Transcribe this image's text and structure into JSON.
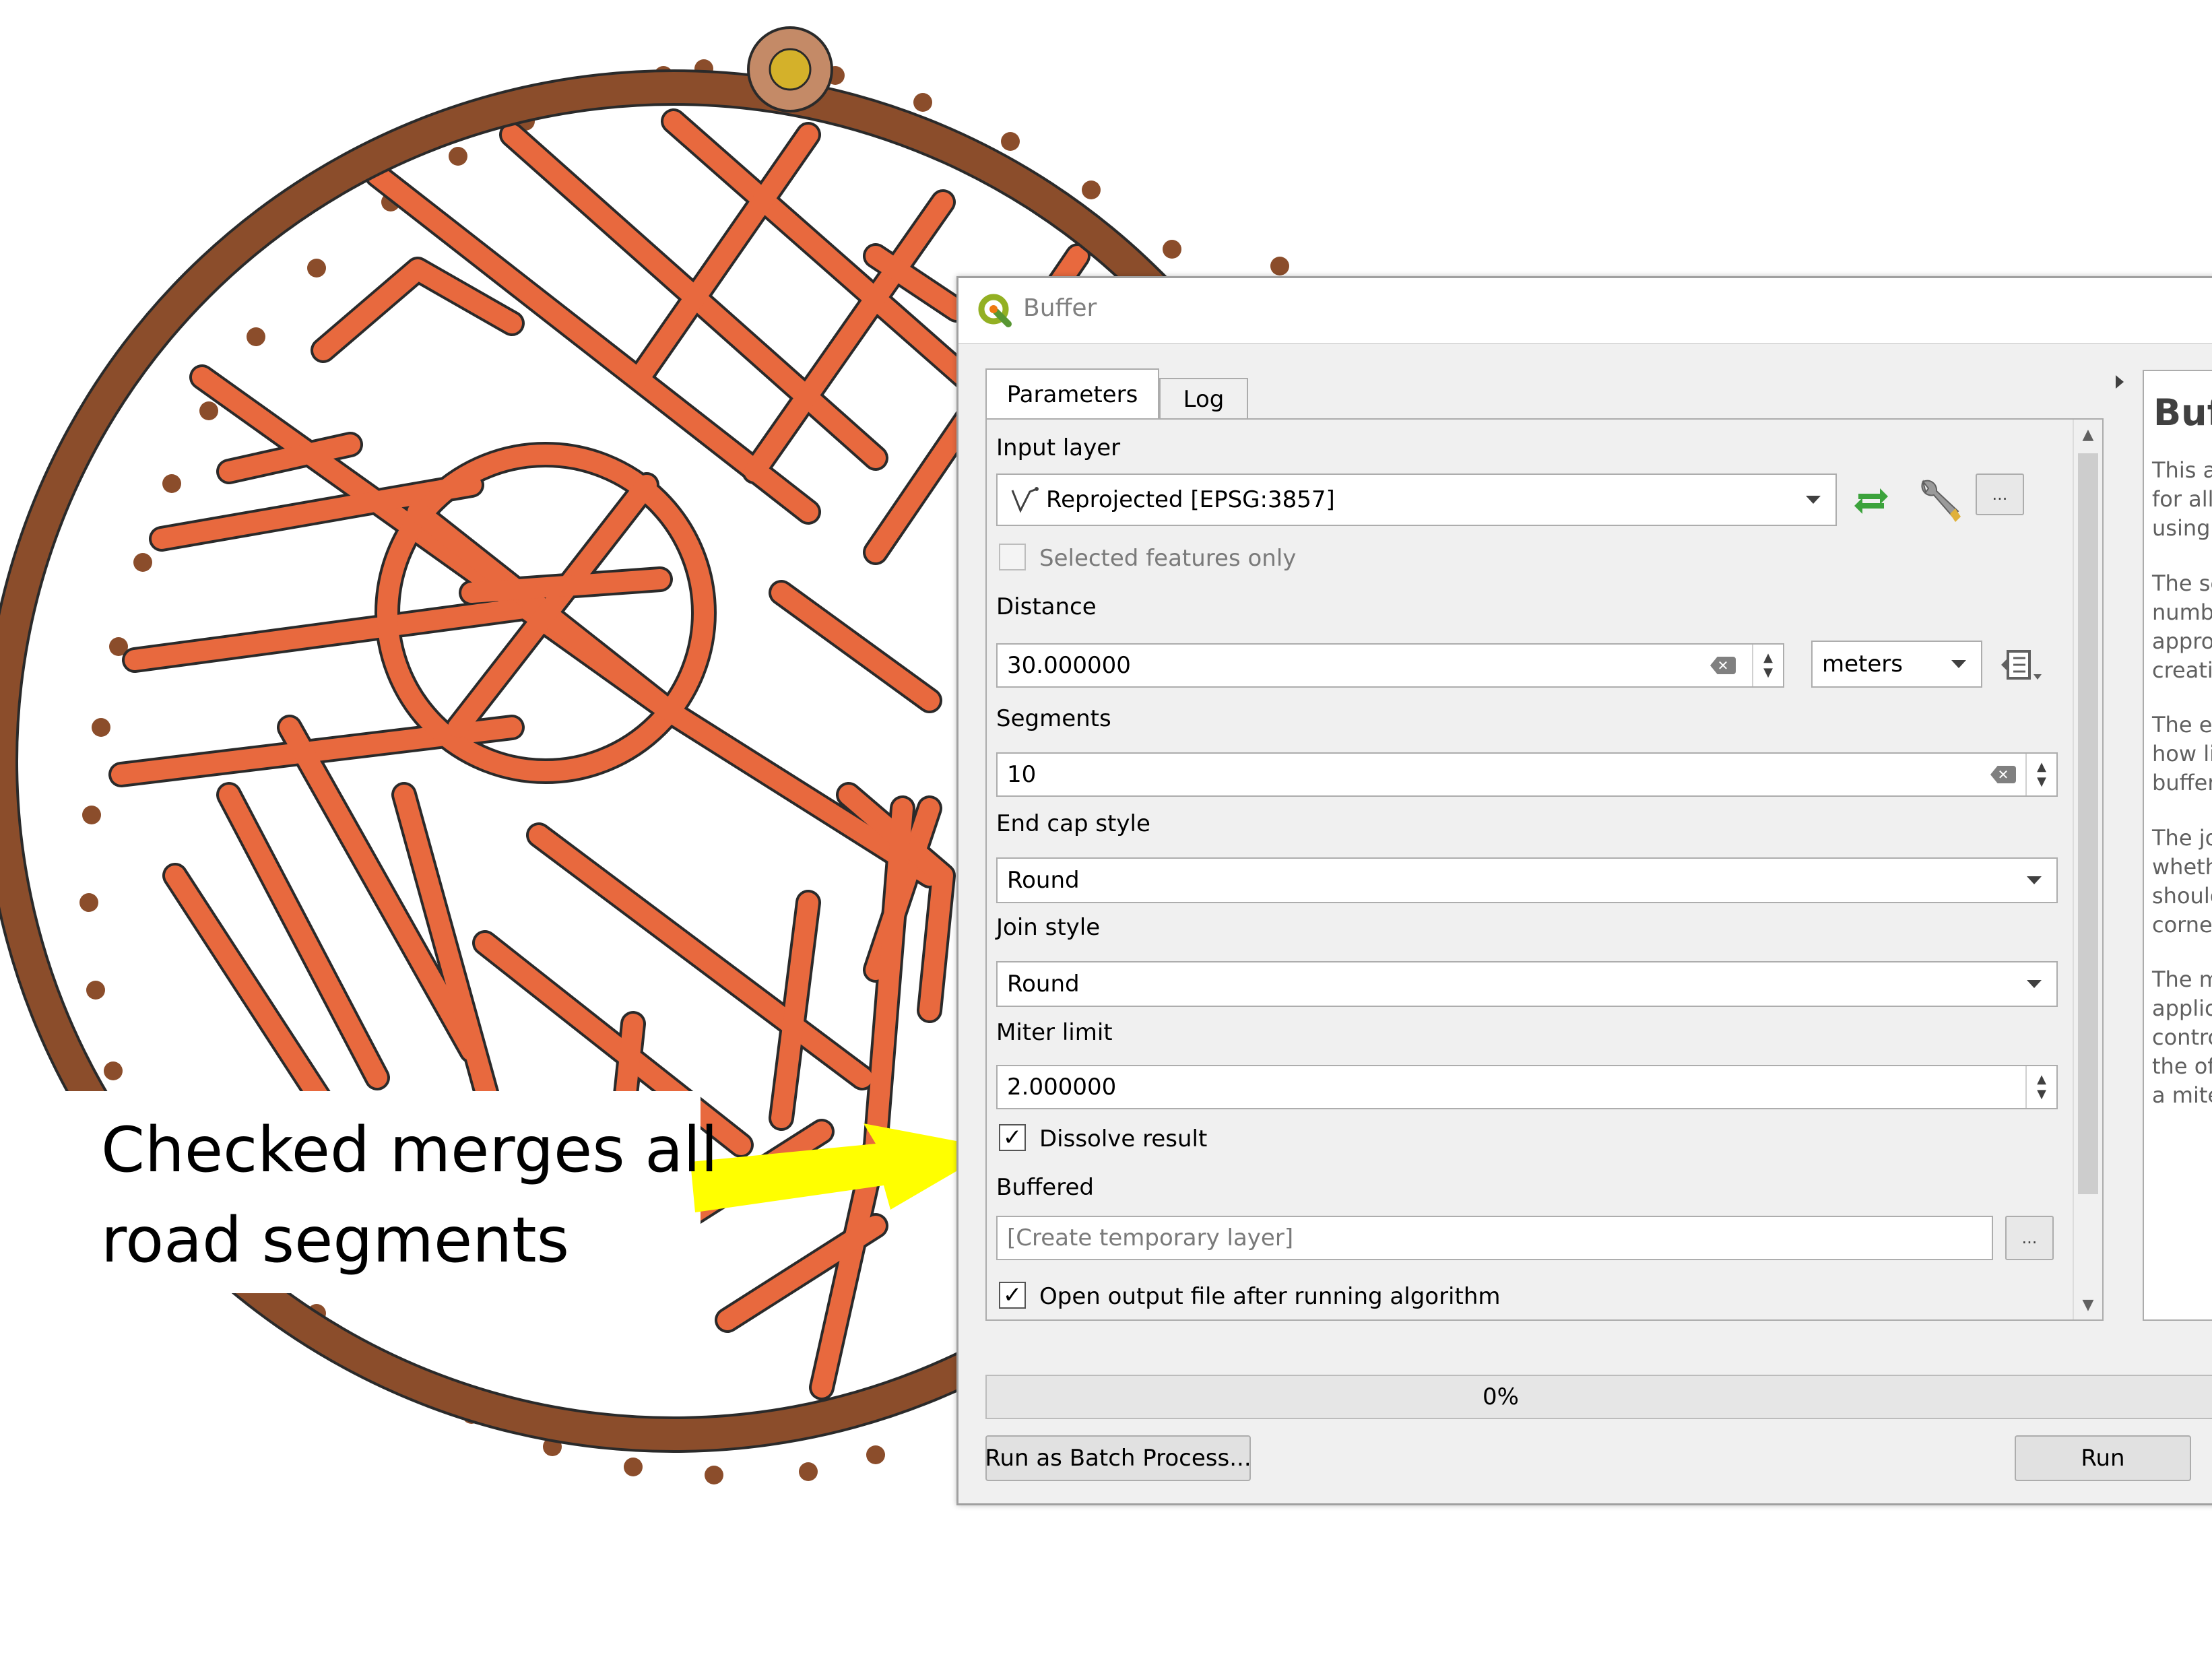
{
  "callout": {
    "line1": "Checked merges all",
    "line2": "road segments"
  },
  "colors": {
    "road_fill": "#e8693e",
    "ring": "#8b4d2b",
    "arrow": "#ffff00",
    "progress": "#06b025"
  },
  "dialog": {
    "title": "Buffer",
    "tabs": [
      "Parameters",
      "Log"
    ],
    "input_layer": {
      "label": "Input layer",
      "value": "Reprojected [EPSG:3857]",
      "icon": "line-layer-icon"
    },
    "selected_only": {
      "label": "Selected features only",
      "checked": false,
      "enabled": false
    },
    "distance": {
      "label": "Distance",
      "value": "30.000000",
      "unit": "meters"
    },
    "segments": {
      "label": "Segments",
      "value": "10"
    },
    "end_cap": {
      "label": "End cap style",
      "value": "Round"
    },
    "join_style": {
      "label": "Join style",
      "value": "Round"
    },
    "miter_limit": {
      "label": "Miter limit",
      "value": "2.000000"
    },
    "dissolve": {
      "label": "Dissolve result",
      "checked": true,
      "check_mark": "✓"
    },
    "buffered": {
      "label": "Buffered",
      "placeholder": "[Create temporary layer]"
    },
    "open_output": {
      "label": "Open output file after running algorithm",
      "checked": true,
      "check_mark": "✓"
    },
    "browse_label": "...",
    "progress": {
      "value": 0,
      "text": "0%"
    },
    "buttons": {
      "batch": "Run as Batch Process...",
      "run": "Run"
    },
    "help": {
      "title": "Buf",
      "p1": "This a\nfor all\nusing",
      "p2": "The se\nnumbe\nappro\ncreatin",
      "p3": "The en\nhow li\nbuffer",
      "p4": "The jo\nwheth\nshould\ncorner",
      "p5": "The m\napplica\ncontro\nthe of\na mite"
    }
  }
}
